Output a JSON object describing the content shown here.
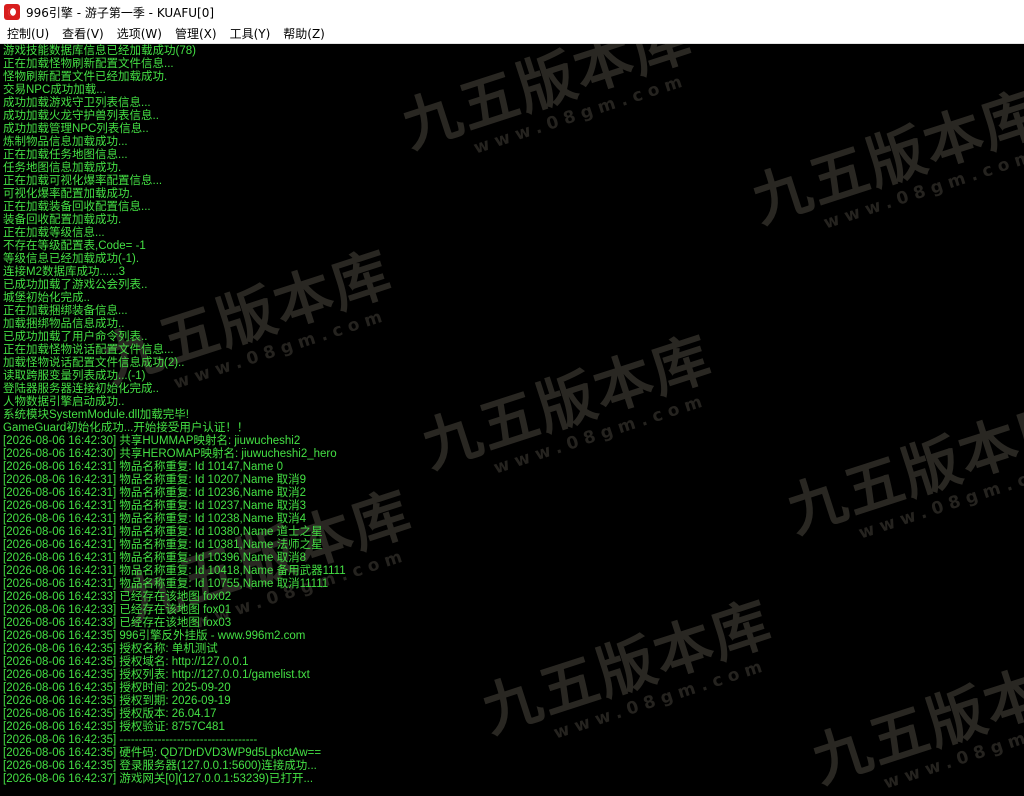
{
  "window": {
    "title": "996引擎 - 游子第一季 - KUAFU[0]"
  },
  "menu": {
    "items": [
      "控制(U)",
      "查看(V)",
      "选项(W)",
      "管理(X)",
      "工具(Y)",
      "帮助(Z)"
    ]
  },
  "watermark": {
    "text": "九五版本库",
    "url": "www.08gm.com"
  },
  "colors": {
    "console_bg": "#000000",
    "log_text": "#44e044"
  },
  "log_lines": [
    "游戏技能数据库信息已经加载成功(78)",
    "正在加载怪物刷新配置文件信息...",
    "怪物刷新配置文件已经加载成功.",
    "交易NPC成功加载...",
    "成功加载游戏守卫列表信息...",
    "成功加载火龙守护兽列表信息..",
    "成功加载管理NPC列表信息..",
    "炼制物品信息加载成功...",
    "正在加载任务地图信息...",
    "任务地图信息加载成功.",
    "正在加载可视化爆率配置信息...",
    "可视化爆率配置加载成功.",
    "正在加载装备回收配置信息...",
    "装备回收配置加载成功.",
    "正在加载等级信息...",
    "不存在等级配置表,Code= -1",
    "等级信息已经加载成功(-1).",
    "连接M2数据库成功......3",
    "已成功加载了游戏公会列表..",
    "城堡初始化完成..",
    "正在加载捆绑装备信息...",
    "加载捆绑物品信息成功..",
    "已成功加载了用户命令列表..",
    "正在加载怪物说话配置文件信息...",
    "加载怪物说话配置文件信息成功(2)..",
    "读取跨服变量列表成功...(-1)",
    "登陆器服务器连接初始化完成..",
    "人物数据引擎启动成功..",
    "系统模块SystemModule.dll加载完毕!",
    "GameGuard初始化成功...开始接受用户认证！！",
    "[2026-08-06 16:42:30] 共享HUMMAP映射名: jiuwucheshi2",
    "[2026-08-06 16:42:30] 共享HEROMAP映射名: jiuwucheshi2_hero",
    "[2026-08-06 16:42:31] 物品名称重复: Id 10147,Name 0",
    "[2026-08-06 16:42:31] 物品名称重复: Id 10207,Name 取消9",
    "[2026-08-06 16:42:31] 物品名称重复: Id 10236,Name 取消2",
    "[2026-08-06 16:42:31] 物品名称重复: Id 10237,Name 取消3",
    "[2026-08-06 16:42:31] 物品名称重复: Id 10238,Name 取消4",
    "[2026-08-06 16:42:31] 物品名称重复: Id 10380,Name 道士之星",
    "[2026-08-06 16:42:31] 物品名称重复: Id 10381,Name 法师之星",
    "[2026-08-06 16:42:31] 物品名称重复: Id 10396,Name 取消8",
    "[2026-08-06 16:42:31] 物品名称重复: Id 10418,Name 备用武器1111",
    "[2026-08-06 16:42:31] 物品名称重复: Id 10755,Name 取消11111",
    "[2026-08-06 16:42:33] 已经存在该地图 fox02",
    "[2026-08-06 16:42:33] 已经存在该地图 fox01",
    "[2026-08-06 16:42:33] 已经存在该地图 fox03",
    "[2026-08-06 16:42:35] 996引擎反外挂版 - www.996m2.com",
    "[2026-08-06 16:42:35] 授权名称: 单机测试",
    "[2026-08-06 16:42:35] 授权域名: http://127.0.0.1",
    "[2026-08-06 16:42:35] 授权列表: http://127.0.0.1/gamelist.txt",
    "[2026-08-06 16:42:35] 授权时间: 2025-09-20",
    "[2026-08-06 16:42:35] 授权到期: 2026-09-19",
    "[2026-08-06 16:42:35] 授权版本: 26.04.17",
    "[2026-08-06 16:42:35] 授权验证: 8757C481",
    "[2026-08-06 16:42:35] ------------------------------------",
    "[2026-08-06 16:42:35] 硬件码: QD7DrDVD3WP9d5LpkctAw==",
    "[2026-08-06 16:42:35] 登录服务器(127.0.0.1:5600)连接成功...",
    "[2026-08-06 16:42:37] 游戏网关[0](127.0.0.1:53239)已打开..."
  ]
}
